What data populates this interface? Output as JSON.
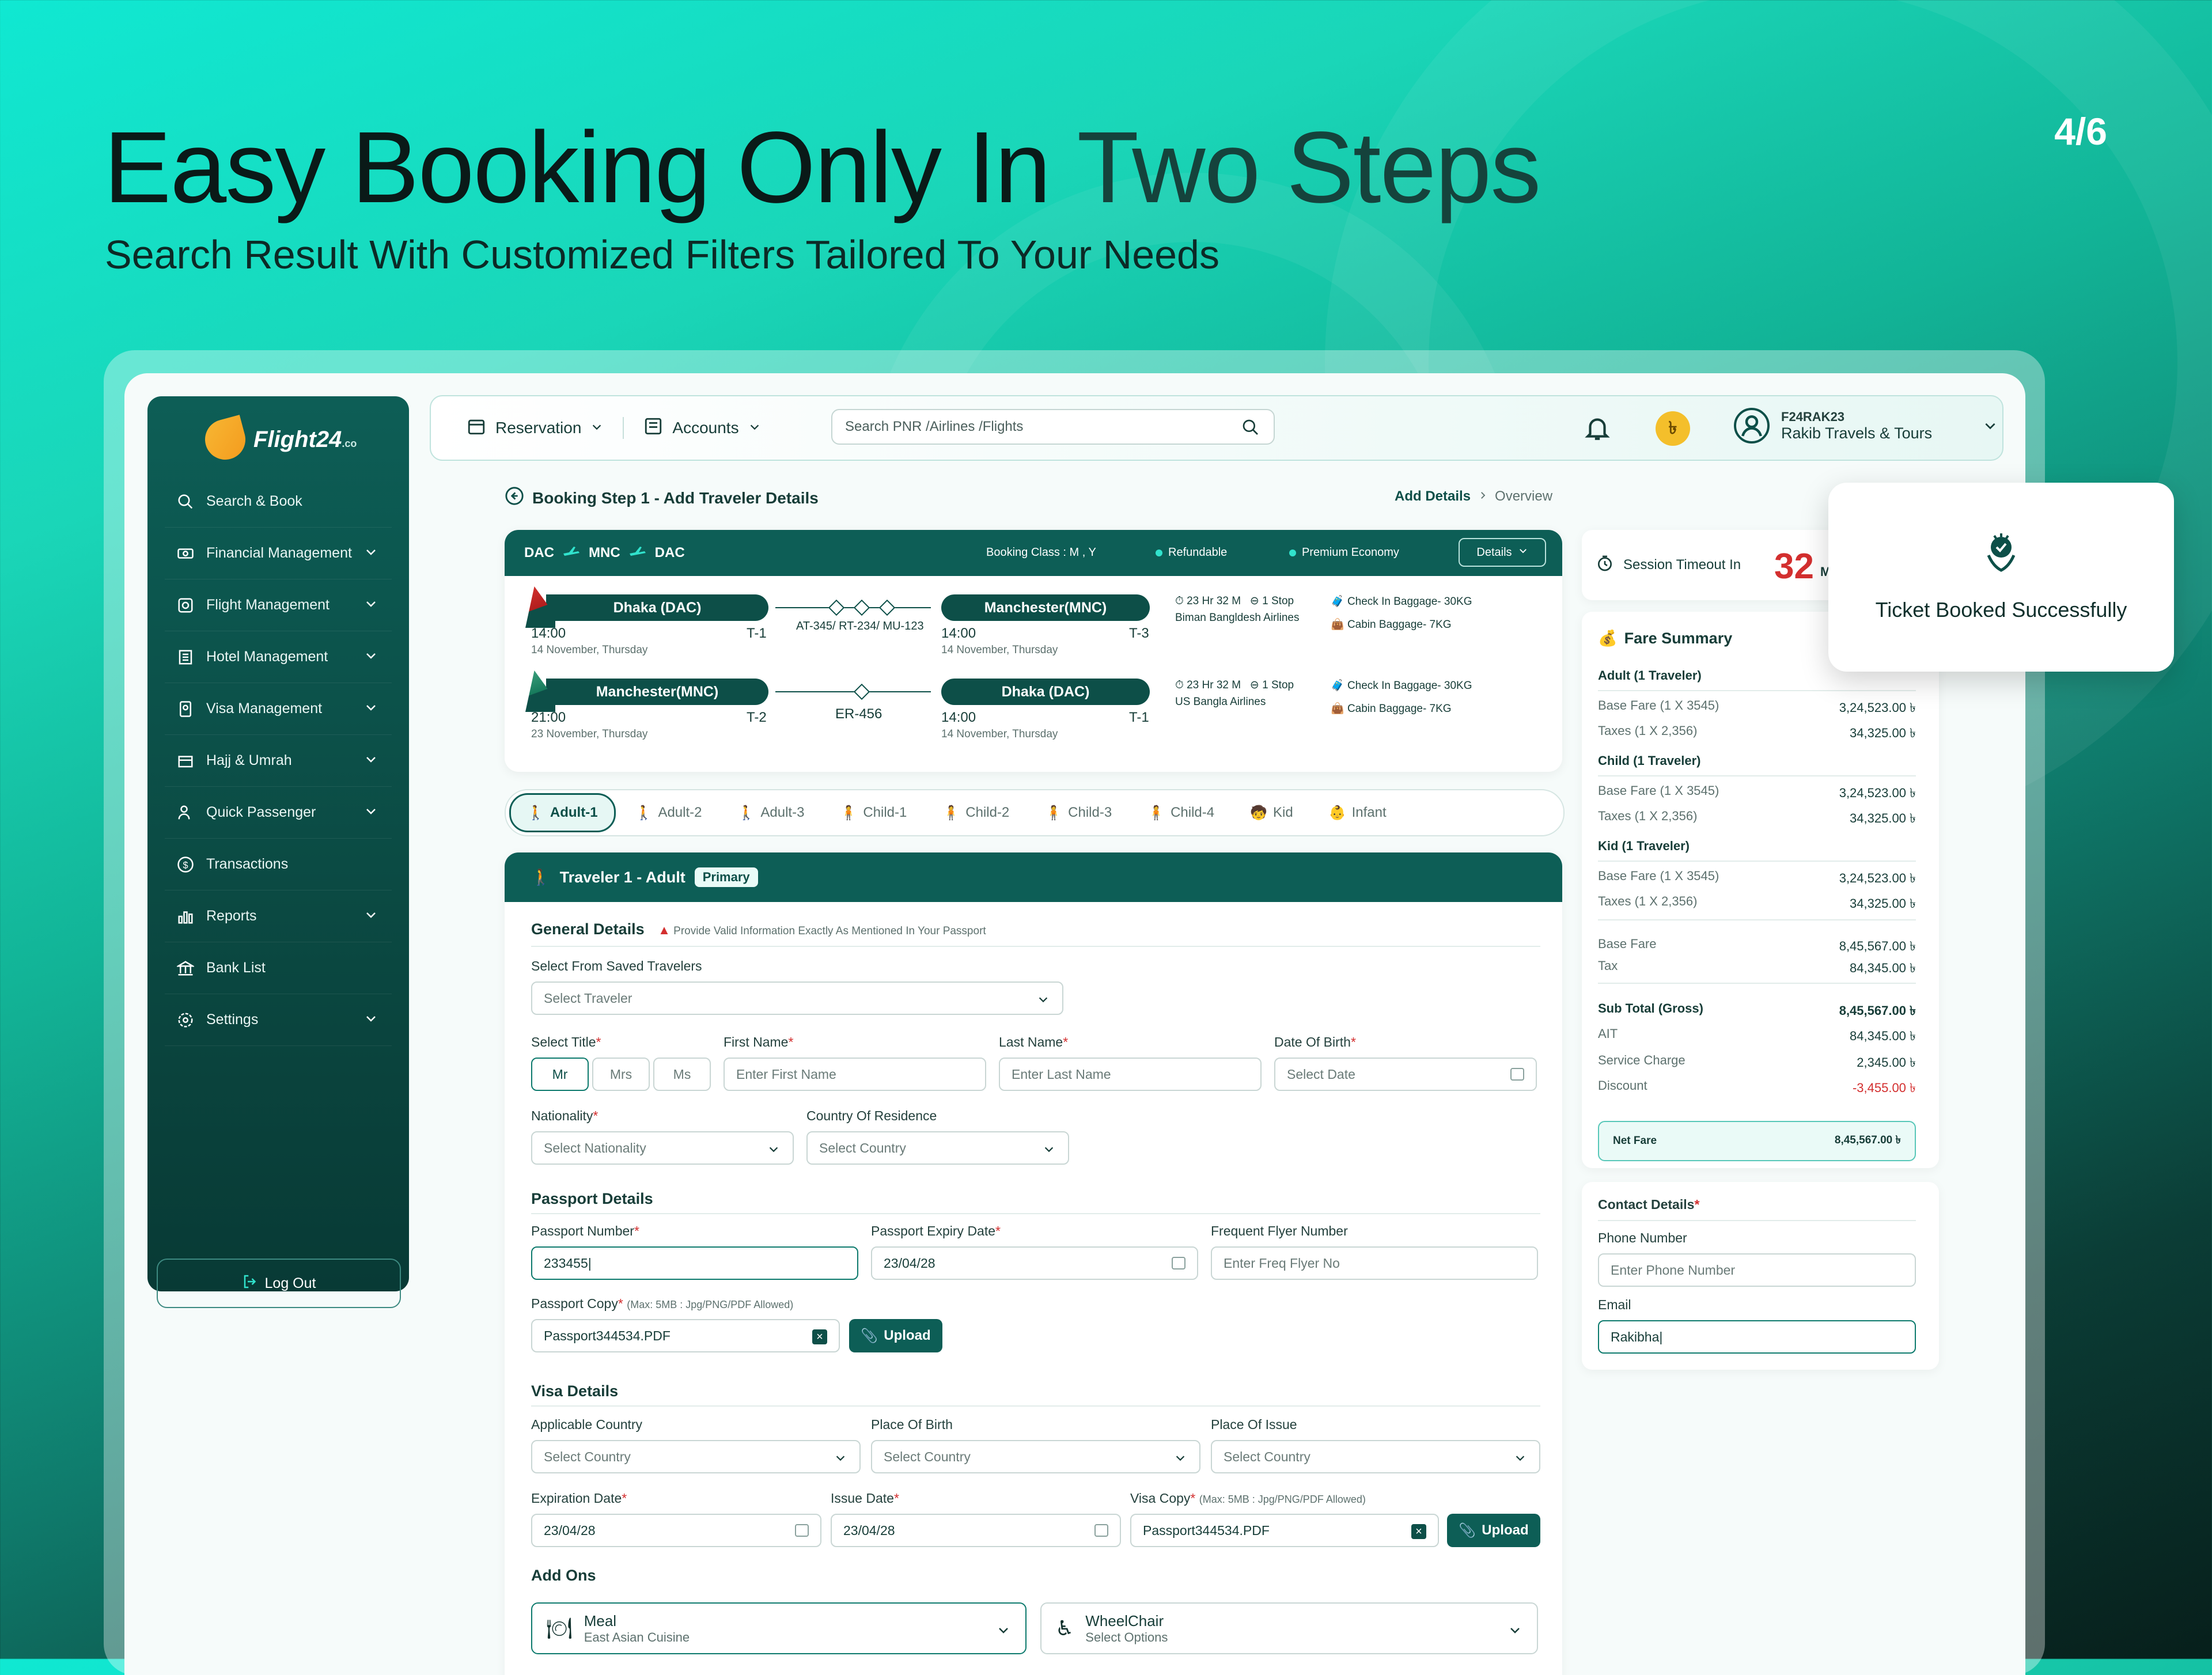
{
  "hero": {
    "title_bold": "Easy Booking Only In",
    "title_light": "Two Steps",
    "subtitle": "Search Result With Customized Filters Tailored To Your Needs",
    "page_count": "4/6"
  },
  "brand": {
    "name": "Flight24",
    "suffix": ".co",
    "accent": "#0d5e56"
  },
  "sidebar": {
    "items": [
      {
        "label": "Search & Book",
        "icon": "search-icon",
        "has_chevron": false
      },
      {
        "label": "Financial Management",
        "icon": "money-icon",
        "has_chevron": true
      },
      {
        "label": "Flight Management",
        "icon": "flight-icon",
        "has_chevron": true
      },
      {
        "label": "Hotel Management",
        "icon": "hotel-icon",
        "has_chevron": true
      },
      {
        "label": "Visa Management",
        "icon": "visa-icon",
        "has_chevron": true
      },
      {
        "label": "Hajj & Umrah",
        "icon": "hajj-icon",
        "has_chevron": true
      },
      {
        "label": "Quick Passenger",
        "icon": "passenger-icon",
        "has_chevron": true
      },
      {
        "label": "Transactions",
        "icon": "transaction-icon",
        "has_chevron": false
      },
      {
        "label": "Reports",
        "icon": "reports-icon",
        "has_chevron": true
      },
      {
        "label": "Bank List",
        "icon": "bank-icon",
        "has_chevron": false
      },
      {
        "label": "Settings",
        "icon": "settings-icon",
        "has_chevron": true
      }
    ],
    "logout": "Log Out"
  },
  "topbar": {
    "reservation": "Reservation",
    "accounts": "Accounts",
    "search_placeholder": "Search PNR /Airlines /Flights",
    "currency_symbol": "৳",
    "user_code": "F24RAK23",
    "user_name": "Rakib Travels & Tours"
  },
  "step": {
    "title": "Booking Step 1 - Add Traveler Details",
    "crumb_active": "Add Details",
    "crumb_next": "Overview"
  },
  "itinerary": {
    "route": [
      "DAC",
      "MNC",
      "DAC"
    ],
    "booking_class": "Booking Class : M , Y",
    "refundable": "Refundable",
    "cabin": "Premium Economy",
    "details": "Details",
    "segments": [
      {
        "from": "Dhaka (DAC)",
        "from_time": "14:00",
        "from_date": "14 November, Thursday",
        "from_terminal": "T-1",
        "flight_no": "AT-345/ RT-234/ MU-123",
        "to": "Manchester(MNC)",
        "to_time": "14:00",
        "to_date": "14 November, Thursday",
        "to_terminal": "T-3",
        "duration": "23 Hr 32 M",
        "stops": "1 Stop",
        "airline": "Biman Bangldesh Airlines",
        "checkin": "Check In Baggage- 30KG",
        "cabin_bag": "Cabin Baggage- 7KG",
        "stops_count": 3
      },
      {
        "from": "Manchester(MNC)",
        "from_time": "21:00",
        "from_date": "23 November, Thursday",
        "from_terminal": "T-2",
        "flight_no": "ER-456",
        "to": "Dhaka (DAC)",
        "to_time": "14:00",
        "to_date": "14 November, Thursday",
        "to_terminal": "T-1",
        "duration": "23 Hr 32 M",
        "stops": "1 Stop",
        "airline": "US Bangla Airlines",
        "checkin": "Check In Baggage- 30KG",
        "cabin_bag": "Cabin Baggage- 7KG",
        "stops_count": 1
      }
    ]
  },
  "traveler_tabs": [
    "Adult-1",
    "Adult-2",
    "Adult-3",
    "Child-1",
    "Child-2",
    "Child-3",
    "Child-4",
    "Kid",
    "Infant"
  ],
  "form": {
    "header": "Traveler 1 - Adult",
    "badge": "Primary",
    "general": "General Details",
    "general_warn": "Provide Valid Information Exactly As Mentioned In Your Passport",
    "saved_label": "Select From Saved Travelers",
    "saved_placeholder": "Select Traveler",
    "title_label": "Select Title",
    "titles": [
      "Mr",
      "Mrs",
      "Ms"
    ],
    "first_name_label": "First Name",
    "first_name_ph": "Enter First Name",
    "last_name_label": "Last Name",
    "last_name_ph": "Enter Last Name",
    "dob_label": "Date Of Birth",
    "dob_ph": "Select Date",
    "nationality_label": "Nationality",
    "nationality_ph": "Select Nationality",
    "residence_label": "Country Of Residence",
    "residence_ph": "Select Country",
    "passport": "Passport Details",
    "passport_no_label": "Passport Number",
    "passport_no_value": "233455|",
    "passport_exp_label": "Passport Expiry Date",
    "passport_exp_value": "23/04/28",
    "ffn_label": "Frequent Flyer Number",
    "ffn_ph": "Enter Freq Flyer No",
    "passport_copy_label": "Passport Copy",
    "passport_copy_hint": "(Max: 5MB : Jpg/PNG/PDF Allowed)",
    "passport_copy_file": "Passport344534.PDF",
    "upload": "Upload",
    "visa": "Visa Details",
    "applicable_country_label": "Applicable Country",
    "place_birth_label": "Place Of Birth",
    "place_issue_label": "Place Of Issue",
    "country_ph": "Select Country",
    "expiration_label": "Expiration Date",
    "expiration_value": "23/04/28",
    "issue_label": "Issue Date",
    "issue_value": "23/04/28",
    "visa_copy_label": "Visa Copy",
    "visa_copy_hint": "(Max: 5MB : Jpg/PNG/PDF Allowed)",
    "visa_copy_file": "Passport344534.PDF",
    "addons": "Add Ons",
    "meal_title": "Meal",
    "meal_value": "East Asian Cuisine",
    "wheelchair_title": "WheelChair",
    "wheelchair_value": "Select Options"
  },
  "session": {
    "label": "Session Timeout In",
    "value": "32",
    "unit": "M"
  },
  "fare": {
    "title": "Fare Summary",
    "groups": [
      {
        "name": "Adult (1 Traveler)",
        "base_label": "Base Fare (1 X 3545)",
        "base": "3,24,523.00 ৳",
        "tax_label": "Taxes (1 X 2,356)",
        "tax": "34,325.00 ৳"
      },
      {
        "name": "Child (1 Traveler)",
        "base_label": "Base Fare (1 X 3545)",
        "base": "3,24,523.00 ৳",
        "tax_label": "Taxes (1 X 2,356)",
        "tax": "34,325.00 ৳"
      },
      {
        "name": "Kid (1 Traveler)",
        "base_label": "Base Fare (1 X 3545)",
        "base": "3,24,523.00 ৳",
        "tax_label": "Taxes (1 X 2,356)",
        "tax": "34,325.00 ৳"
      }
    ],
    "base_fare_label": "Base Fare",
    "base_fare": "8,45,567.00 ৳",
    "tax_label": "Tax",
    "tax": "84,345.00 ৳",
    "subtotal_label": "Sub Total (Gross)",
    "subtotal": "8,45,567.00 ৳",
    "ait_label": "AIT",
    "ait": "84,345.00 ৳",
    "service_label": "Service Charge",
    "service": "2,345.00 ৳",
    "discount_label": "Discount",
    "discount": "-3,455.00 ৳",
    "net_label": "Net Fare",
    "net": "8,45,567.00 ৳"
  },
  "contact": {
    "title": "Contact Details",
    "phone_label": "Phone Number",
    "phone_ph": "Enter Phone Number",
    "email_label": "Email",
    "email_value": "Rakibha|"
  },
  "toast": {
    "message": "Ticket Booked Successfully"
  }
}
